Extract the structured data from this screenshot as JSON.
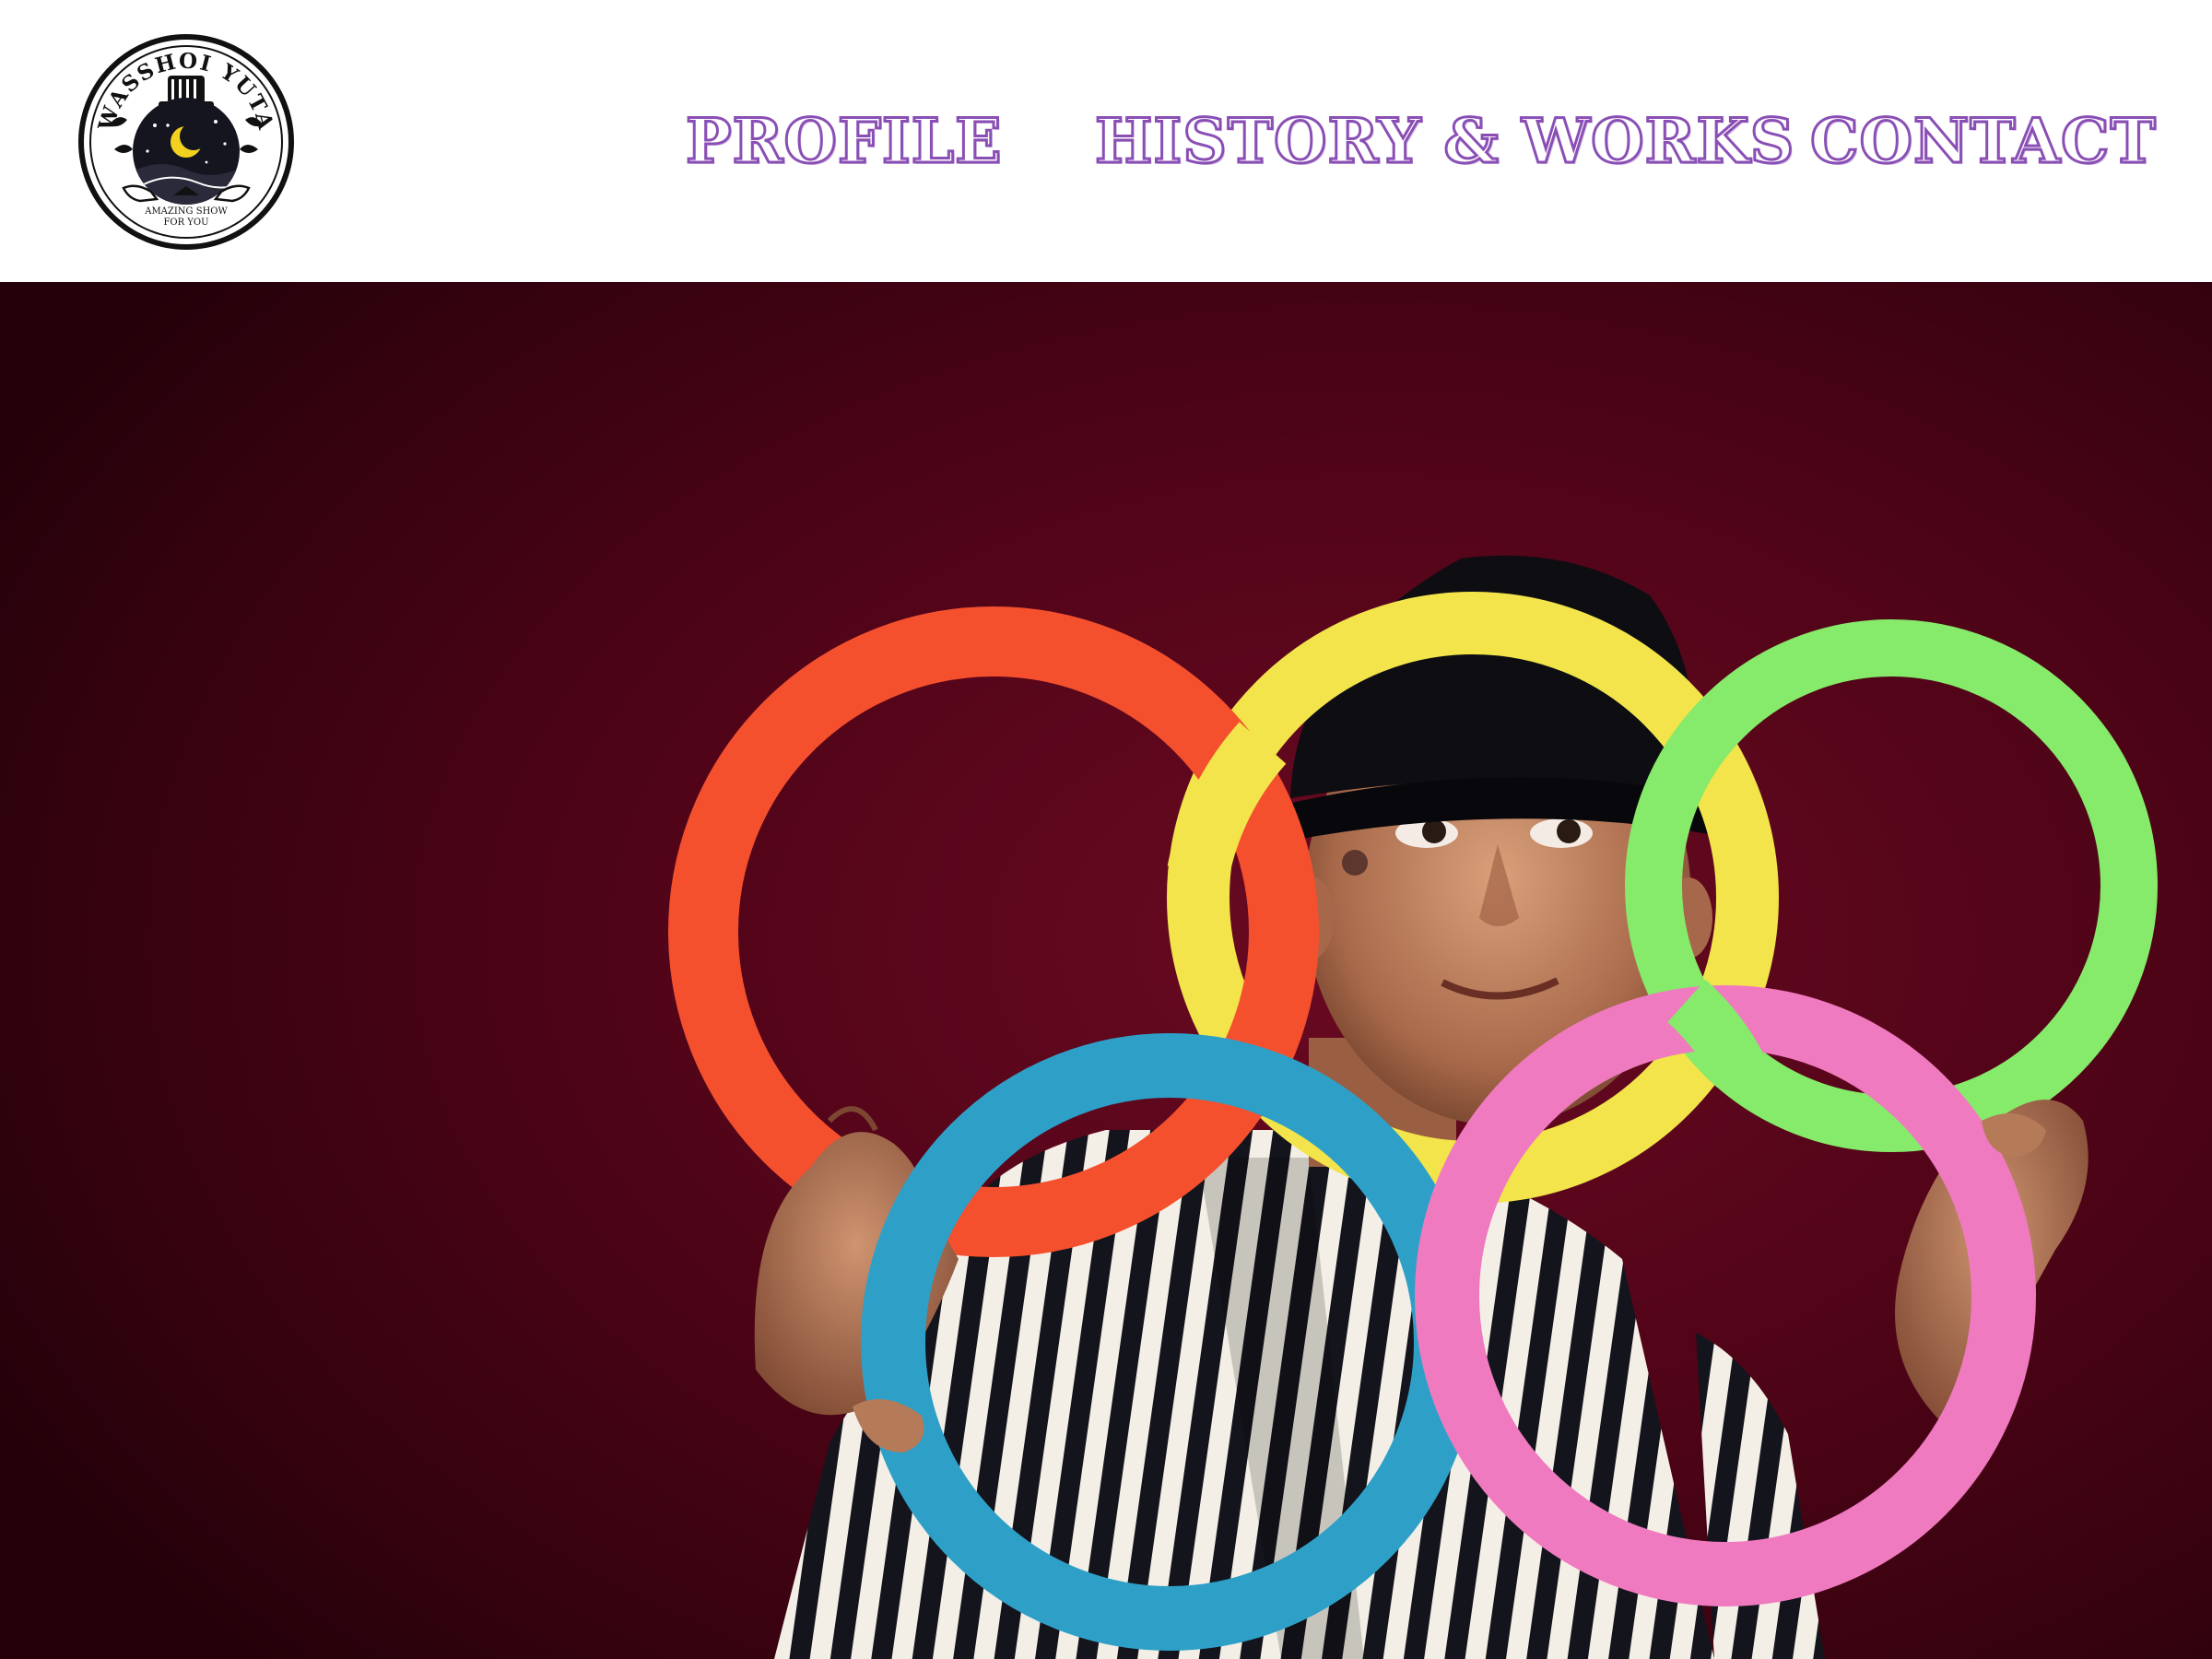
{
  "logo": {
    "name": "WASSHOI YUTA",
    "tagline_line1": "AMAZING SHOW",
    "tagline_line2": "FOR YOU"
  },
  "nav": {
    "items": [
      {
        "label": "PROFILE"
      },
      {
        "label": "HISTORY & WORKS"
      },
      {
        "label": "CONTACT"
      }
    ]
  },
  "colors": {
    "accent": "#8a4fb5",
    "hero_background": "#520418",
    "ring_orange": "#f4502e",
    "ring_yellow": "#f2e44a",
    "ring_green": "#86ea6a",
    "ring_blue": "#2ea0c8",
    "ring_pink": "#f07ac0"
  },
  "hero": {
    "image": "performer-holding-five-juggling-rings"
  }
}
